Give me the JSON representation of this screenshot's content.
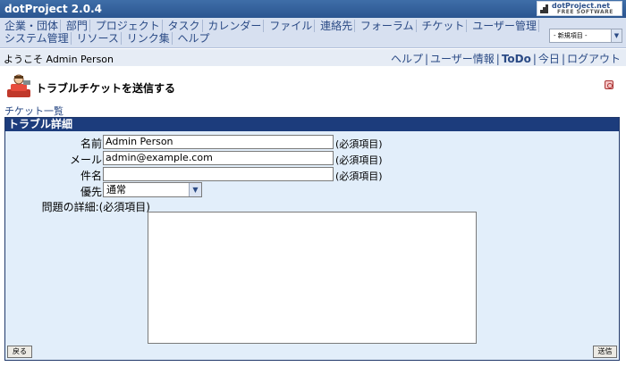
{
  "app": {
    "title": "dotProject 2.0.4"
  },
  "logo": {
    "name": "dotProject.net",
    "sub": "FREE SOFTWARE"
  },
  "menu": {
    "items": [
      "企業・団体",
      "部門",
      "プロジェクト",
      "タスク",
      "カレンダー",
      "ファイル",
      "連絡先",
      "フォーラム",
      "チケット",
      "ユーザー管理",
      "システム管理",
      "リソース",
      "リンク集",
      "ヘルプ"
    ],
    "new_select": "- 新規項目 -"
  },
  "userbar": {
    "welcome": "ようこそ Admin Person",
    "links": [
      "ヘルプ",
      "ユーザー情報",
      "ToDo",
      "今日",
      "ログアウト"
    ]
  },
  "page": {
    "title": "トラブルチケットを送信する",
    "ticket_list": "チケット一覧"
  },
  "form": {
    "header": "トラブル詳細",
    "name_label": "名前:",
    "name_value": "Admin Person",
    "email_label": "メール:",
    "email_value": "admin@example.com",
    "subject_label": "件名:",
    "subject_value": "",
    "priority_label": "優先:",
    "priority_value": "通常",
    "details_label": "問題の詳細:(必須項目)",
    "required": "(必須項目)",
    "back_label": "戻る",
    "submit_label": "送信"
  }
}
